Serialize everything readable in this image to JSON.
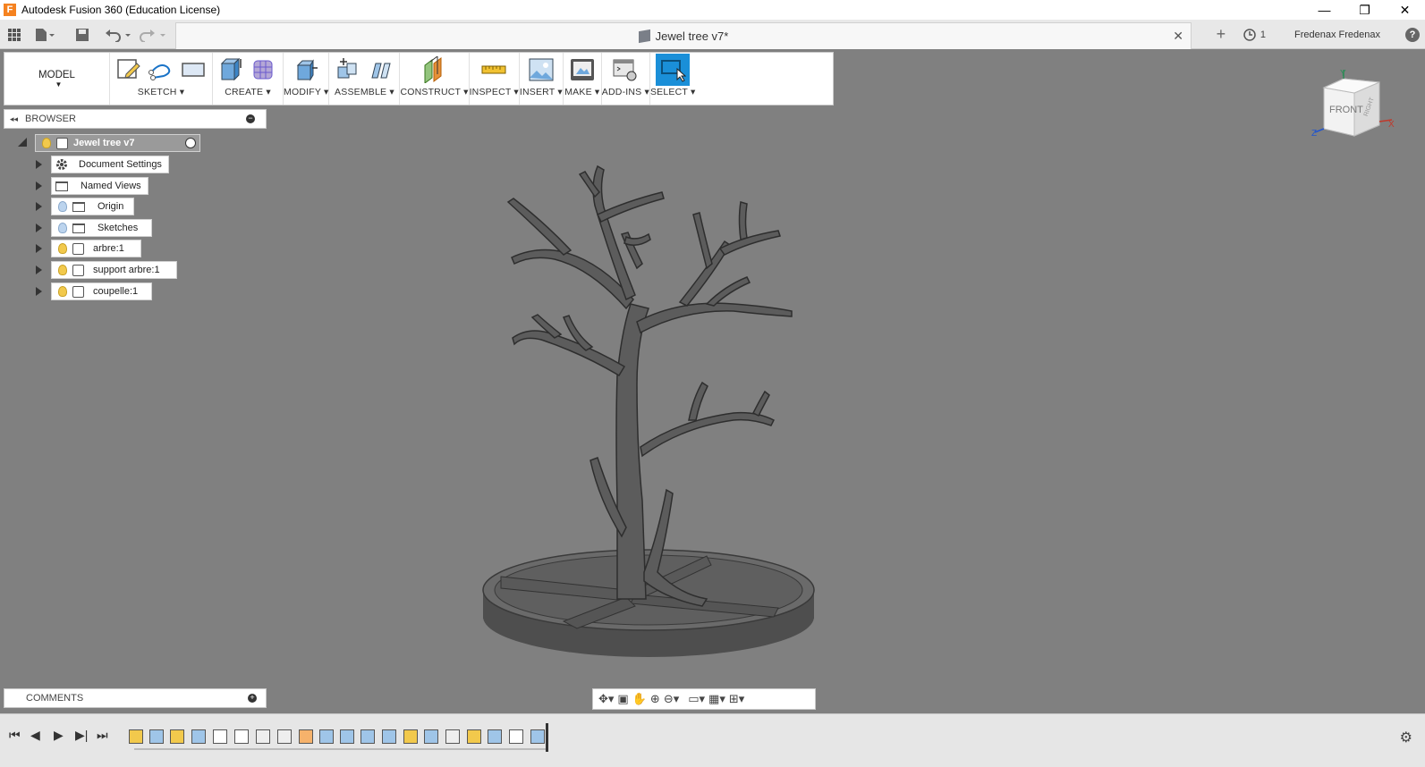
{
  "window": {
    "app_icon_letter": "F",
    "title": "Autodesk Fusion 360 (Education License)",
    "controls": [
      "—",
      "❐",
      "✕"
    ]
  },
  "tabbar": {
    "document_tab": "Jewel tree v7*",
    "job_count": "1",
    "user": "Fredenax Fredenax",
    "help": "?"
  },
  "toolbar": {
    "workspace": "MODEL",
    "groups": {
      "sketch": "SKETCH",
      "create": "CREATE",
      "modify": "MODIFY",
      "assemble": "ASSEMBLE",
      "construct": "CONSTRUCT",
      "inspect": "INSPECT",
      "insert": "INSERT",
      "make": "MAKE",
      "addins": "ADD-INS",
      "select": "SELECT"
    }
  },
  "browser": {
    "title": "BROWSER",
    "root": "Jewel tree v7",
    "items": [
      {
        "label": "Document Settings",
        "icon": "gear-icon"
      },
      {
        "label": "Named Views",
        "icon": "folder-icon"
      },
      {
        "label": "Origin",
        "icon": "folder-icon"
      },
      {
        "label": "Sketches",
        "icon": "folder-icon"
      },
      {
        "label": "arbre:1",
        "icon": "body-icon"
      },
      {
        "label": "support arbre:1",
        "icon": "body-icon"
      },
      {
        "label": "coupelle:1",
        "icon": "body-icon"
      }
    ]
  },
  "comments": {
    "title": "COMMENTS"
  },
  "viewcube": {
    "face": "FRONT",
    "side": "RIGHT",
    "axis_y": "Y",
    "axis_x": "X",
    "axis_z": "Z"
  },
  "colors": {
    "accent_select": "#1a8fd8",
    "viewport": "#808080",
    "model": "#5c5c5c"
  }
}
